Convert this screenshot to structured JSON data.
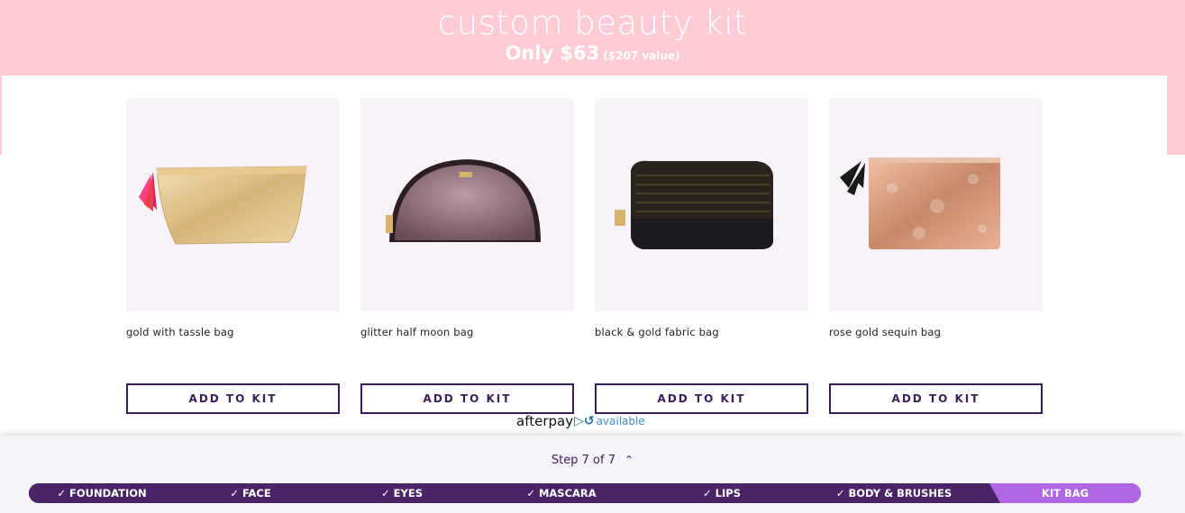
{
  "hero": {
    "title": "custom beauty kit",
    "price": "Only $63",
    "value_note": "($207 value)"
  },
  "products": [
    {
      "name": "gold with tassle bag",
      "button_label": "ADD TO KIT"
    },
    {
      "name": "glitter half moon bag",
      "button_label": "ADD TO KIT"
    },
    {
      "name": "black & gold fabric bag",
      "button_label": "ADD TO KIT"
    },
    {
      "name": "rose gold sequin bag",
      "button_label": "ADD TO KIT"
    }
  ],
  "afterpay": {
    "brand": "afterpay",
    "available": "available"
  },
  "progress": {
    "step_label": "Step 7 of 7",
    "stages": [
      {
        "label": "FOUNDATION",
        "status": "done"
      },
      {
        "label": "FACE",
        "status": "done"
      },
      {
        "label": "EYES",
        "status": "done"
      },
      {
        "label": "MASCARA",
        "status": "done"
      },
      {
        "label": "LIPS",
        "status": "done"
      },
      {
        "label": "BODY & BRUSHES",
        "status": "done"
      },
      {
        "label": "KIT BAG",
        "status": "current"
      }
    ]
  },
  "colors": {
    "hero_pink": "#ffcbd5",
    "brand_purple": "#3b1d57",
    "progress_done": "#4a2466",
    "progress_current": "#b166e3"
  }
}
